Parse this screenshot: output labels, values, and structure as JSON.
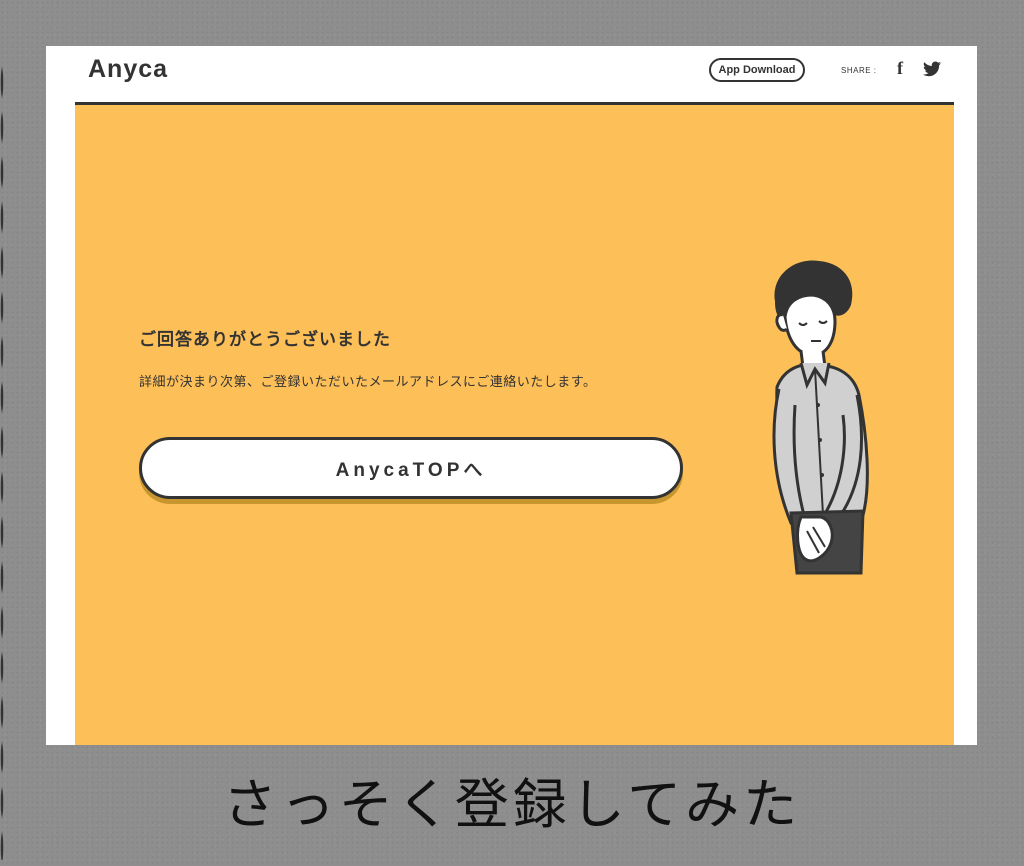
{
  "header": {
    "logo": "Anyca",
    "app_download_label": "App Download",
    "share_label": "SHARE :",
    "facebook_glyph": "f",
    "icons": [
      "facebook-icon",
      "twitter-icon"
    ]
  },
  "main": {
    "thanks_title": "ご回答ありがとうございました",
    "thanks_message": "詳細が決まり次第、ご登録いただいたメールアドレスにご連絡いたします。",
    "top_button_label": "AnycaTOPへ"
  },
  "caption": "さっそく登録してみた",
  "colors": {
    "background": "#8e8e8e",
    "panel": "#fdbf57",
    "text": "#333333",
    "button_shadow": "#c8962f"
  }
}
